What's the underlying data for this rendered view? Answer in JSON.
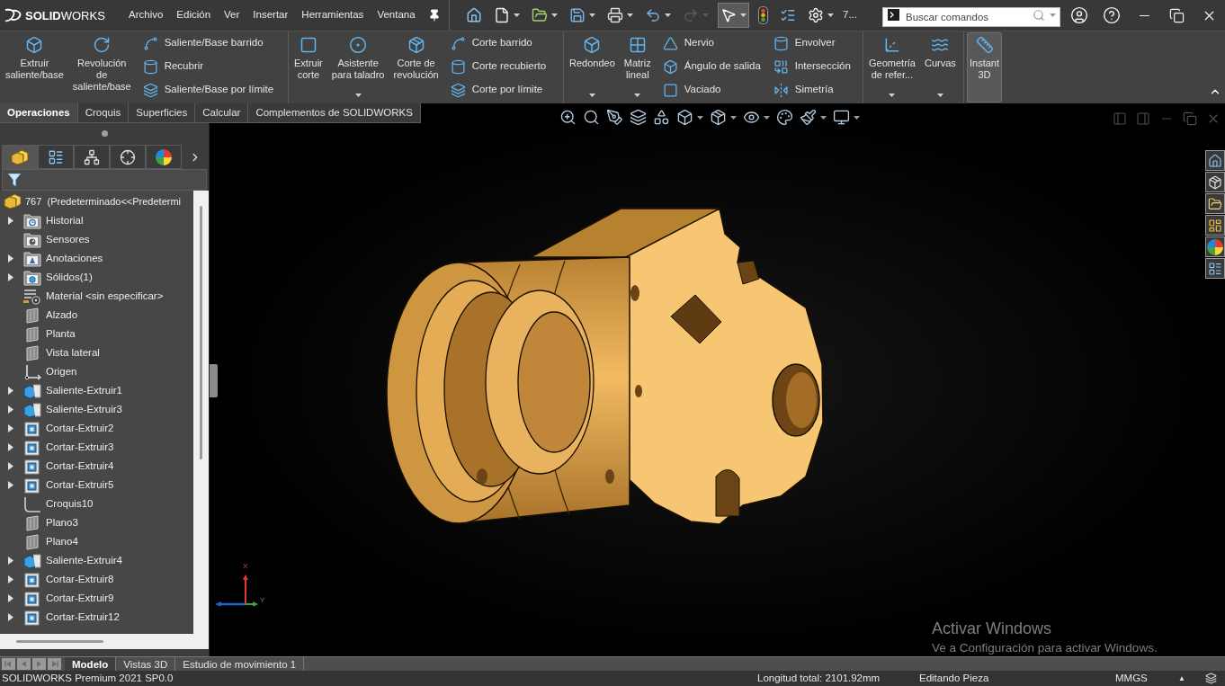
{
  "title_bar": {
    "logo": "**SOLID**WORKS",
    "menus": [
      "Archivo",
      "Edición",
      "Ver",
      "Insertar",
      "Herramientas",
      "Ventana"
    ],
    "quick_access": [
      {
        "dropdown": false,
        "pressed": false,
        "disabled": false
      },
      {
        "dropdown": true,
        "pressed": false,
        "disabled": false
      },
      {
        "dropdown": true,
        "pressed": false,
        "disabled": false
      },
      {
        "dropdown": true,
        "pressed": false,
        "disabled": false
      },
      {
        "dropdown": true,
        "pressed": false,
        "disabled": false
      },
      {
        "dropdown": true,
        "pressed": false,
        "disabled": false
      },
      {
        "dropdown": true,
        "pressed": false,
        "disabled": true
      },
      {
        "dropdown": true,
        "pressed": true,
        "disabled": false
      },
      {
        "dropdown": false,
        "pressed": false,
        "disabled": false
      },
      {
        "dropdown": false,
        "pressed": false,
        "disabled": false
      },
      {
        "dropdown": true,
        "pressed": false,
        "disabled": false
      }
    ],
    "overflow": "7...",
    "search": {
      "placeholder": "Buscar comandos"
    }
  },
  "ribbon": {
    "groups": [
      {
        "items": [
          {
            "kind": "large",
            "label": "Extruir\nsaliente/base",
            "dropdown": false,
            "pressed": false
          },
          {
            "kind": "large",
            "label": "Revolución\nde\nsaliente/base",
            "dropdown": false,
            "pressed": false
          },
          {
            "kind": "stack",
            "items": [
              {
                "label": "Saliente/Base barrido",
                "pressed": false
              },
              {
                "label": "Recubrir",
                "pressed": false
              },
              {
                "label": "Saliente/Base por límite",
                "pressed": false
              }
            ]
          }
        ]
      },
      {
        "items": [
          {
            "kind": "large",
            "label": "Extruir\ncorte",
            "dropdown": false,
            "pressed": false
          },
          {
            "kind": "large",
            "label": "Asistente\npara taladro",
            "dropdown": true,
            "pressed": false
          },
          {
            "kind": "large",
            "label": "Corte de\nrevolución",
            "dropdown": false,
            "pressed": false
          },
          {
            "kind": "stack",
            "items": [
              {
                "label": "Corte barrido",
                "pressed": false
              },
              {
                "label": "Corte recubierto",
                "pressed": false
              },
              {
                "label": "Corte por límite",
                "pressed": false
              }
            ]
          }
        ]
      },
      {
        "items": [
          {
            "kind": "large",
            "label": "Redondeo",
            "dropdown": true,
            "pressed": false
          },
          {
            "kind": "large",
            "label": "Matriz\nlineal",
            "dropdown": true,
            "pressed": false
          },
          {
            "kind": "stack",
            "items": [
              {
                "label": "Nervio",
                "pressed": false
              },
              {
                "label": "Ángulo de salida",
                "pressed": false
              },
              {
                "label": "Vaciado",
                "pressed": false
              }
            ]
          },
          {
            "kind": "stack",
            "items": [
              {
                "label": "Envolver",
                "pressed": false
              },
              {
                "label": "Intersección",
                "pressed": false
              },
              {
                "label": "Simetría",
                "pressed": false
              }
            ]
          }
        ]
      },
      {
        "items": [
          {
            "kind": "large",
            "label": "Geometría\nde refer...",
            "dropdown": true,
            "pressed": false
          },
          {
            "kind": "large",
            "label": "Curvas",
            "dropdown": true,
            "pressed": false
          }
        ]
      },
      {
        "items": [
          {
            "kind": "large",
            "label": "Instant\n3D",
            "dropdown": false,
            "pressed": true
          }
        ]
      }
    ]
  },
  "command_tabs": [
    {
      "label": "Operaciones",
      "selected": true
    },
    {
      "label": "Croquis",
      "selected": false
    },
    {
      "label": "Superficies",
      "selected": false
    },
    {
      "label": "Calcular",
      "selected": false
    },
    {
      "label": "Complementos de SOLIDWORKS",
      "selected": false
    }
  ],
  "feature_panel": {
    "tabs": [
      {
        "selected": true
      },
      {
        "selected": false
      },
      {
        "selected": false
      },
      {
        "selected": false
      },
      {
        "selected": false
      }
    ],
    "tree": {
      "label": "767  (Predeterminado<<Predetermi",
      "children": [
        {
          "label": "Historial",
          "kind": "history",
          "expanded": false
        },
        {
          "label": "Sensores",
          "kind": "sensors"
        },
        {
          "label": "Anotaciones",
          "kind": "annotations",
          "expanded": false
        },
        {
          "label": "Sólidos(1)",
          "kind": "solids",
          "expanded": false
        },
        {
          "label": "Material <sin especificar>",
          "kind": "material"
        },
        {
          "label": "Alzado",
          "kind": "plane"
        },
        {
          "label": "Planta",
          "kind": "plane"
        },
        {
          "label": "Vista lateral",
          "kind": "plane"
        },
        {
          "label": "Origen",
          "kind": "origin"
        },
        {
          "label": "Saliente-Extruir1",
          "kind": "boss",
          "expanded": false
        },
        {
          "label": "Saliente-Extruir3",
          "kind": "boss",
          "expanded": false
        },
        {
          "label": "Cortar-Extruir2",
          "kind": "cut",
          "expanded": false
        },
        {
          "label": "Cortar-Extruir3",
          "kind": "cut",
          "expanded": false
        },
        {
          "label": "Cortar-Extruir4",
          "kind": "cut",
          "expanded": false
        },
        {
          "label": "Cortar-Extruir5",
          "kind": "cut",
          "expanded": false
        },
        {
          "label": "Croquis10",
          "kind": "sketch"
        },
        {
          "label": "Plano3",
          "kind": "plane"
        },
        {
          "label": "Plano4",
          "kind": "plane"
        },
        {
          "label": "Saliente-Extruir4",
          "kind": "boss",
          "expanded": false
        },
        {
          "label": "Cortar-Extruir8",
          "kind": "cut",
          "expanded": false
        },
        {
          "label": "Cortar-Extruir9",
          "kind": "cut",
          "expanded": false
        },
        {
          "label": "Cortar-Extruir12",
          "kind": "cut",
          "expanded": false
        }
      ]
    }
  },
  "viewport": {
    "triad": {
      "x_axis": "X",
      "y_axis": "Y"
    },
    "os_notice": {
      "title": "Activar Windows",
      "text": "Ve a Configuración para activar Windows."
    }
  },
  "bottom_tabs": [
    {
      "label": "Modelo",
      "selected": true
    },
    {
      "label": "Vistas 3D",
      "selected": false
    },
    {
      "label": "Estudio de movimiento 1",
      "selected": false
    }
  ],
  "status_bar": {
    "product": "SOLIDWORKS Premium 2021 SP0.0",
    "total_length": "Longitud total: 2101.92mm",
    "mode": "Editando Pieza",
    "units": "MMGS",
    "units_arrow": "▲"
  }
}
